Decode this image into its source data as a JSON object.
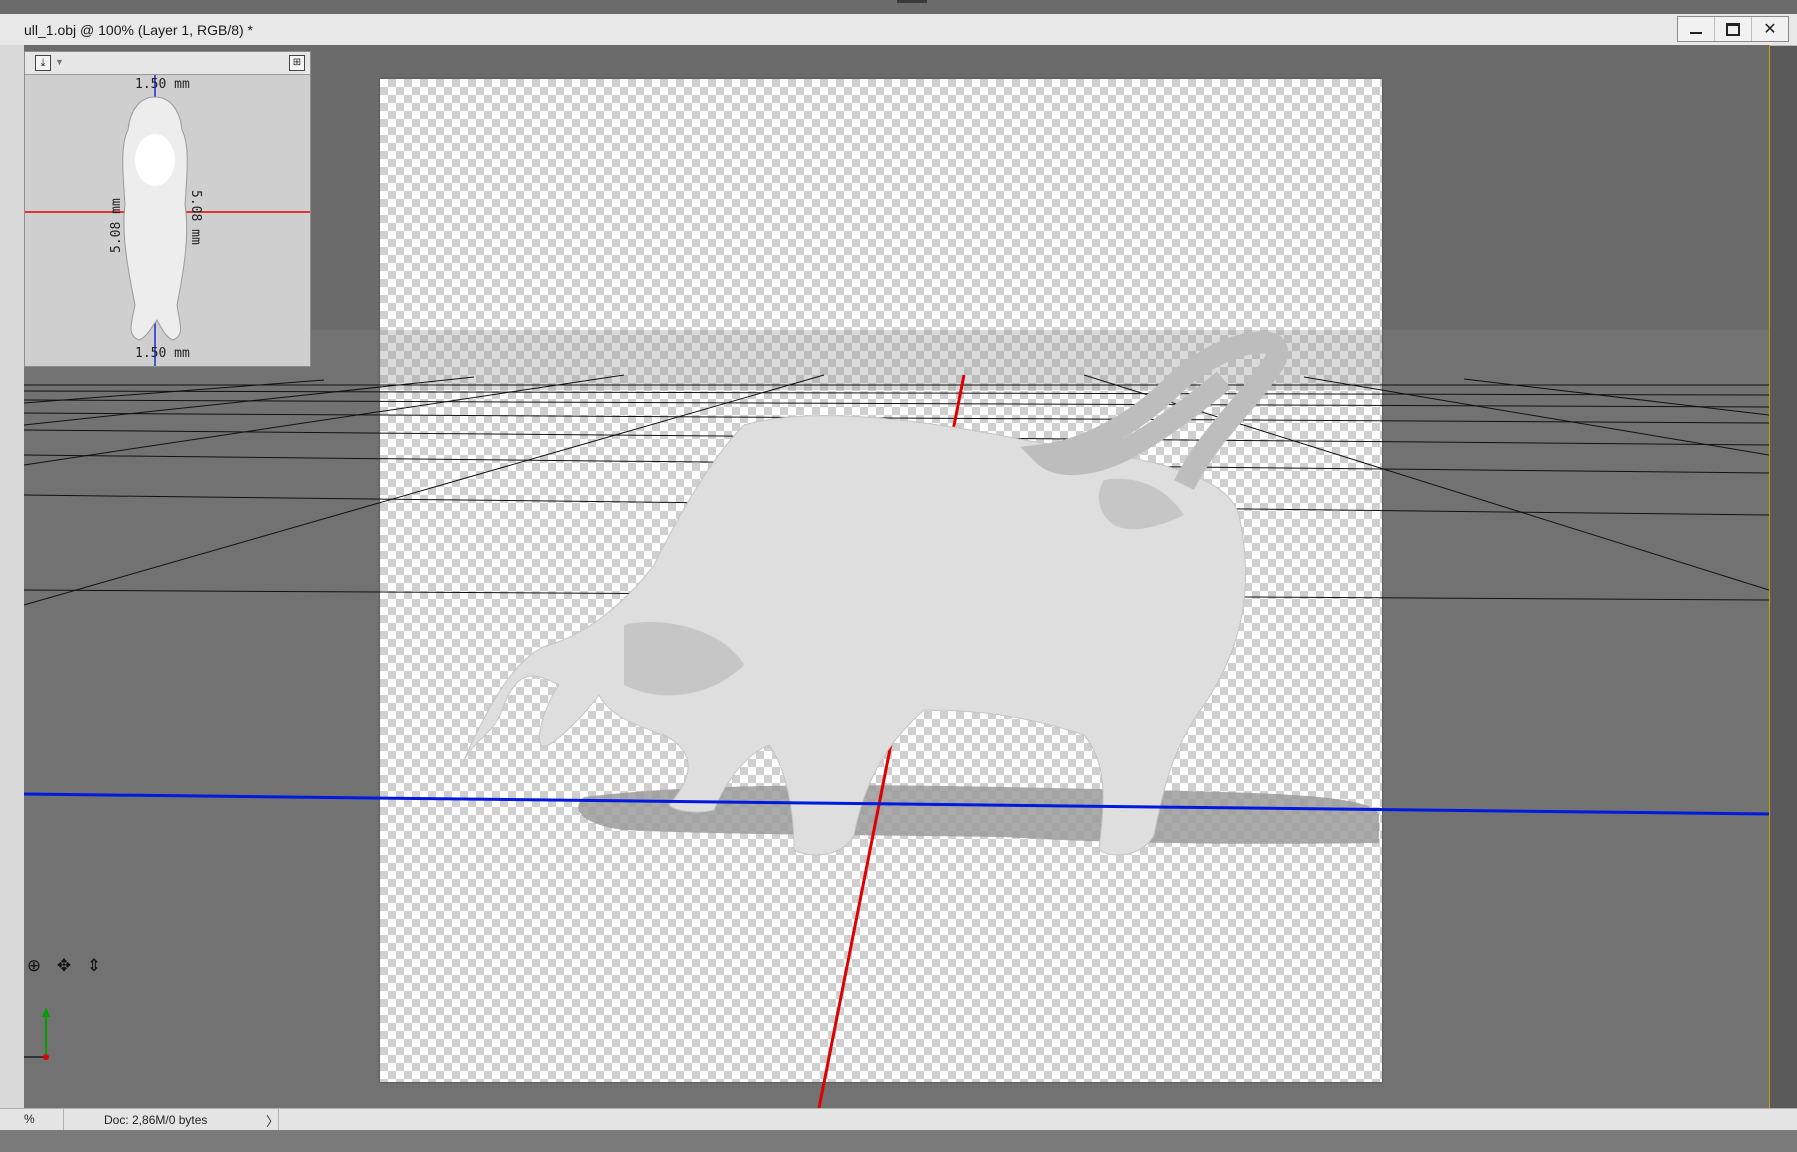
{
  "window": {
    "title": "ull_1.obj @ 100% (Layer 1, RGB/8) *",
    "controls": {
      "minimize": "–",
      "restore": "□",
      "close": "✕"
    }
  },
  "navigator": {
    "dim_top": "1.50 mm",
    "dim_bottom": "1.50 mm",
    "dim_left": "5.08 mm",
    "dim_right": "5.08 mm",
    "icons": [
      "download-icon",
      "expand-panel-icon"
    ]
  },
  "axis_tools": {
    "icons": [
      "orbit-icon",
      "pan-icon",
      "dolly-icon"
    ]
  },
  "status": {
    "zoom": "%",
    "doc_info": "Doc: 2,86M/0 bytes",
    "menu_arrow": "〉"
  },
  "colors": {
    "x_axis": "#e00000",
    "z_axis": "#0018e0",
    "y_axis": "#00a000",
    "workspace": "#6b6b6b"
  }
}
